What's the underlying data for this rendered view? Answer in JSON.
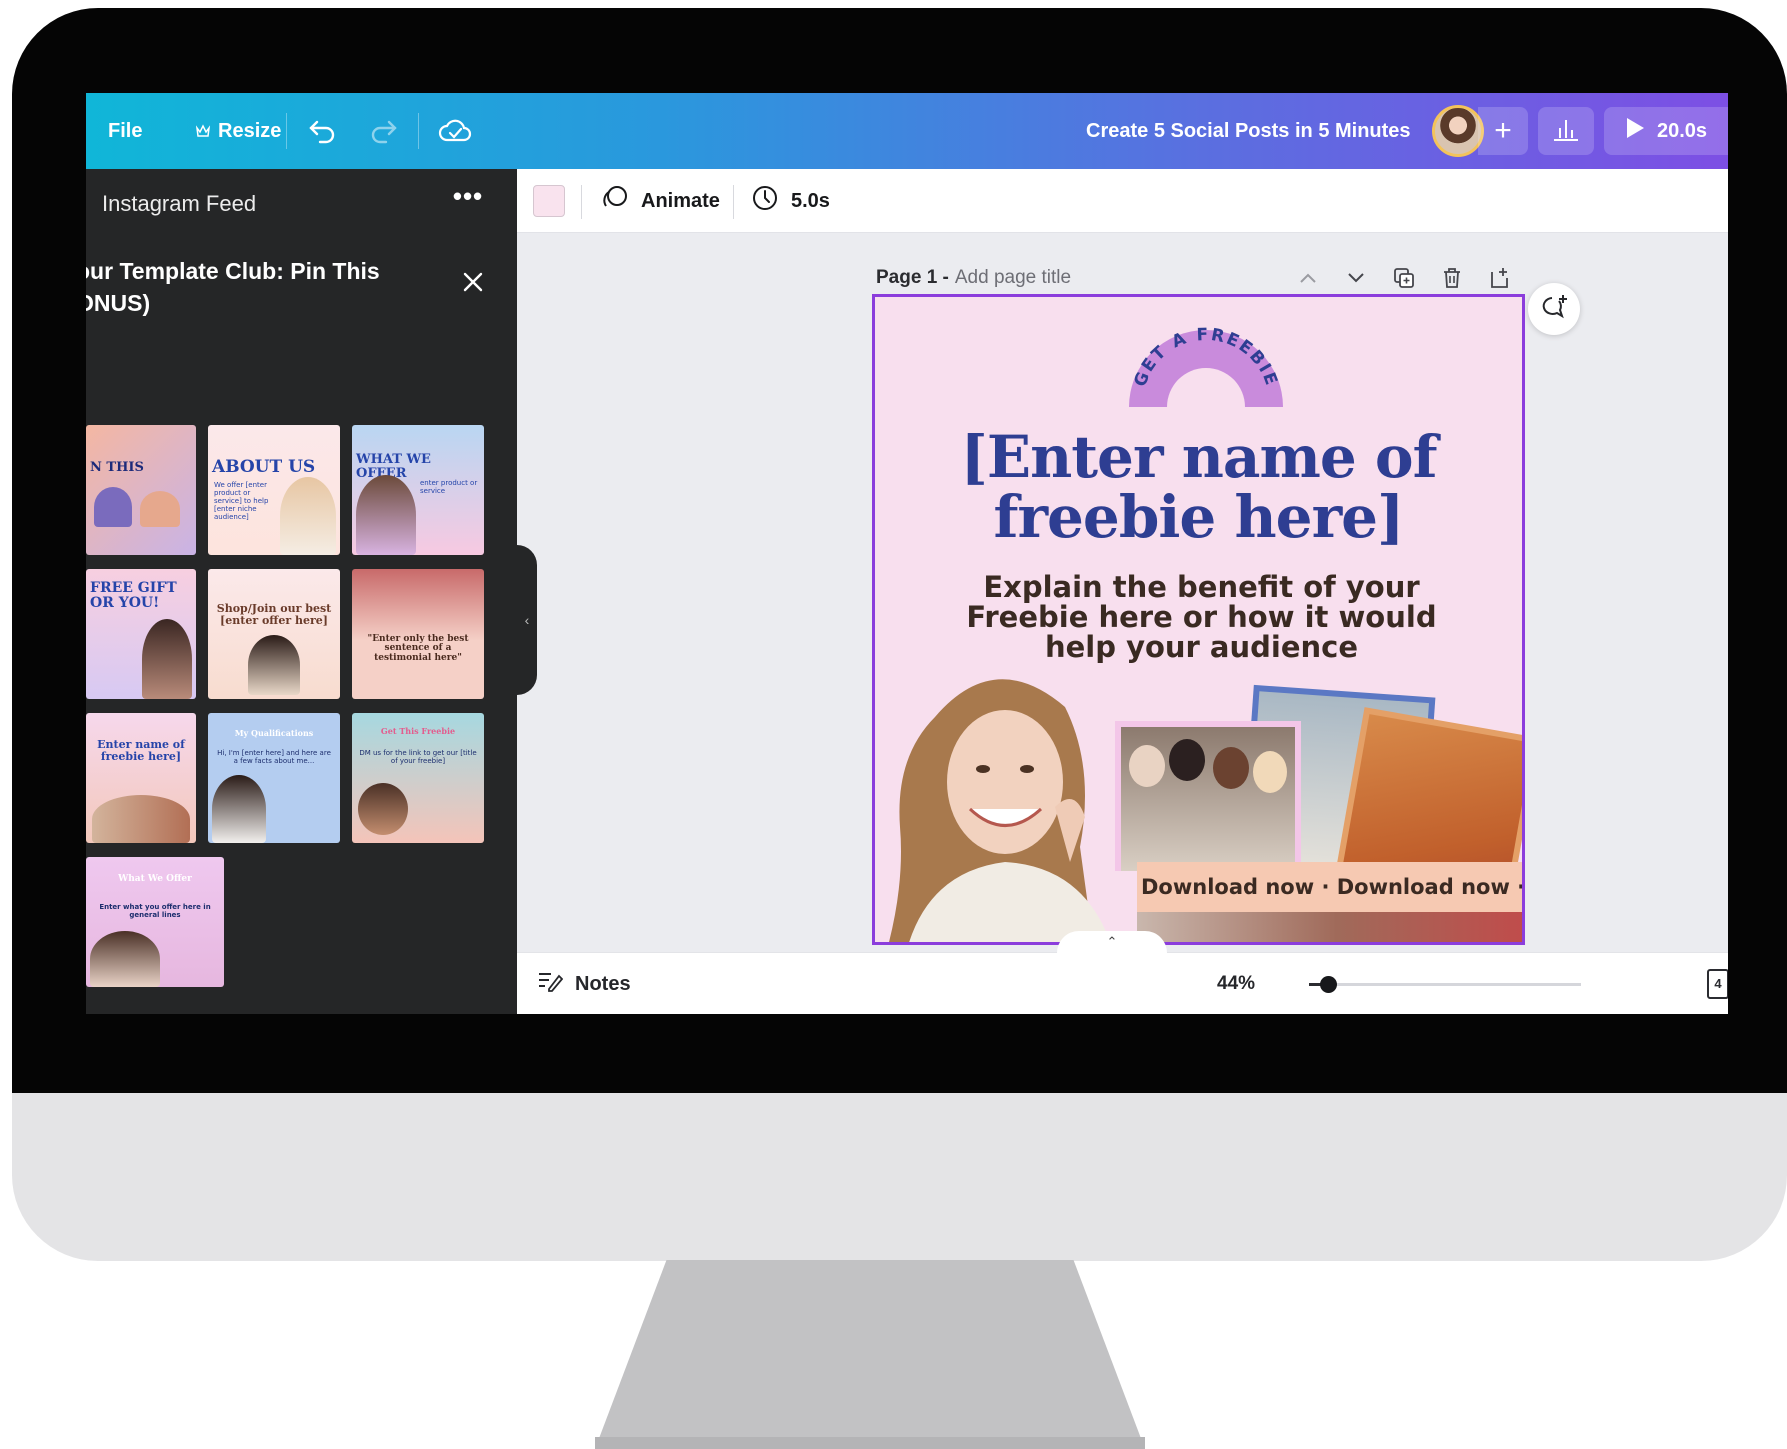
{
  "topbar": {
    "file_label": "File",
    "resize_label": "Resize",
    "project_title": "Create 5 Social Posts in 5 Minutes",
    "present_duration": "20.0s",
    "plus_label": "+"
  },
  "panel": {
    "title": "Instagram Feed",
    "more_label": "•••",
    "subtitle_line1": "our Template Club: Pin This",
    "subtitle_line2": "ONUS)",
    "thumbnails": [
      {
        "title": "N THIS"
      },
      {
        "title": "ABOUT US",
        "text": "We offer [enter product or service] to help [enter niche audience]"
      },
      {
        "title": "WHAT WE OFFER",
        "text": "enter product or service"
      },
      {
        "title": "FREE GIFT OR YOU!"
      },
      {
        "title": "Shop/Join our best [enter offer here]"
      },
      {
        "title": "\"Enter only the best sentence of a testimonial here\""
      },
      {
        "title": "Enter name of freebie here]"
      },
      {
        "title": "My Qualifications",
        "text": "Hi, I'm [enter here] and here are a few facts about me..."
      },
      {
        "title": "Get This Freebie",
        "text": "DM us for the link to get our [title of your freebie]"
      },
      {
        "title": "What We Offer",
        "text": "Enter what you offer here in general lines"
      }
    ]
  },
  "editor": {
    "animate_label": "Animate",
    "duration_label": "5.0s",
    "swatch_color": "#f9e3ee",
    "page_number": "Page 1 -",
    "page_title_placeholder": "Add page title"
  },
  "design": {
    "badge_text": "GET A FREEBIE",
    "title": "[Enter name of freebie here]",
    "subtitle": "Explain the benefit of your Freebie here or how it would help your audience",
    "strip_text": "Download now · Download now · Dc",
    "accent_color": "#2e3e92",
    "badge_color": "#c788d8"
  },
  "footer": {
    "notes_label": "Notes",
    "zoom_label": "44%",
    "zoom_fraction": 0.07,
    "pages_count": "4"
  }
}
